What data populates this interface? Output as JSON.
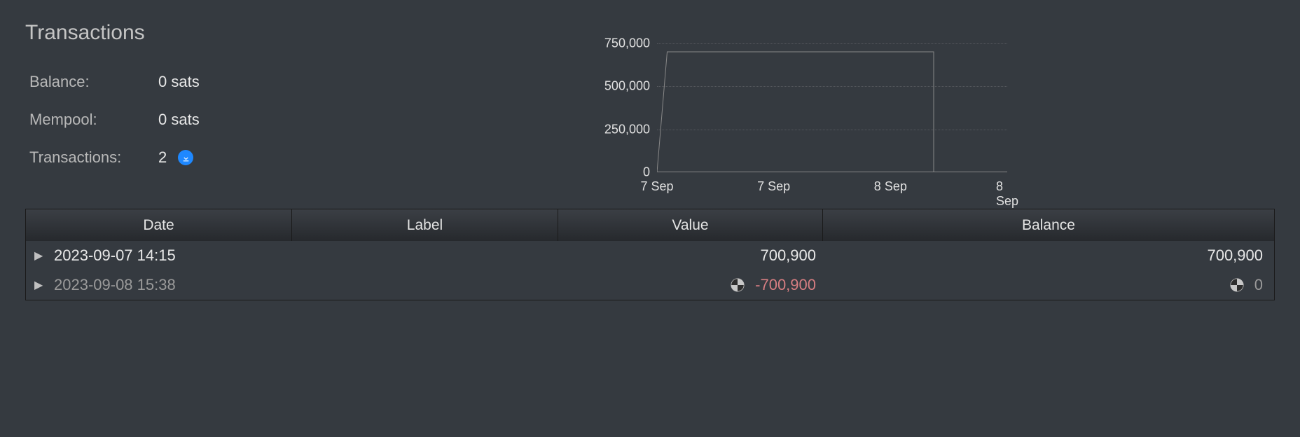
{
  "title": "Transactions",
  "stats": {
    "balance_label": "Balance:",
    "balance_value": "0 sats",
    "mempool_label": "Mempool:",
    "mempool_value": "0 sats",
    "tx_label": "Transactions:",
    "tx_value": "2"
  },
  "chart_data": {
    "type": "line",
    "title": "",
    "xlabel": "",
    "ylabel": "",
    "ylim": [
      0,
      750000
    ],
    "yticks": [
      0,
      250000,
      500000,
      750000
    ],
    "ytick_labels": [
      "0",
      "250,000",
      "500,000",
      "750,000"
    ],
    "xtick_labels": [
      "7 Sep",
      "7 Sep",
      "8 Sep",
      "8 Sep"
    ],
    "x": [
      0,
      0.029,
      0.79,
      0.79,
      1.0
    ],
    "values": [
      0,
      700900,
      700900,
      0,
      0
    ]
  },
  "table": {
    "headers": {
      "date": "Date",
      "label": "Label",
      "value": "Value",
      "balance": "Balance"
    },
    "rows": [
      {
        "date": "2023-09-07 14:15",
        "label": "",
        "value": "700,900",
        "balance": "700,900",
        "dim": false,
        "neg": false,
        "pie": false
      },
      {
        "date": "2023-09-08 15:38",
        "label": "",
        "value": "-700,900",
        "balance": "0",
        "dim": true,
        "neg": true,
        "pie": true
      }
    ]
  }
}
